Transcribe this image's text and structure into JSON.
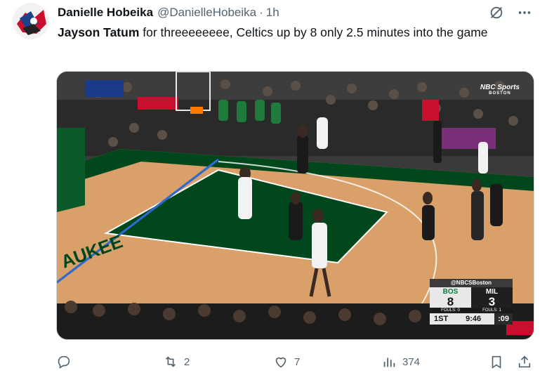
{
  "tweet": {
    "display_name": "Danielle Hobeika",
    "handle": "@DanielleHobeika",
    "separator": "·",
    "time": "1h",
    "text_mention": "Jayson Tatum",
    "text_rest": " for threeeeeeee, Celtics up by 8 only 2.5 minutes into the game"
  },
  "header_icons": [
    "grok-icon",
    "more-icon"
  ],
  "media": {
    "broadcaster_logo": "NBC Sports",
    "broadcaster_sub": "BOSTON",
    "scorebug": {
      "network": "@NBCSBoston",
      "home": {
        "abbr": "BOS",
        "score": "8",
        "fouls": "FOULS: 0"
      },
      "away": {
        "abbr": "MIL",
        "score": "3",
        "fouls": "FOULS: 1"
      },
      "period": "1ST",
      "clock": "9:46",
      "shot_clock": ":09"
    }
  },
  "actions": {
    "reply": {
      "icon": "reply-icon",
      "count": ""
    },
    "retweet": {
      "icon": "retweet-icon",
      "count": "2"
    },
    "like": {
      "icon": "heart-icon",
      "count": "7"
    },
    "views": {
      "icon": "views-icon",
      "count": "374"
    },
    "bookmark": {
      "icon": "bookmark-icon"
    },
    "share": {
      "icon": "share-icon"
    }
  },
  "colors": {
    "text": "#0f1419",
    "muted": "#536471",
    "celtics_green": "#0b7b3e",
    "bucks_green": "#00471b",
    "court": "#d9a06a"
  }
}
